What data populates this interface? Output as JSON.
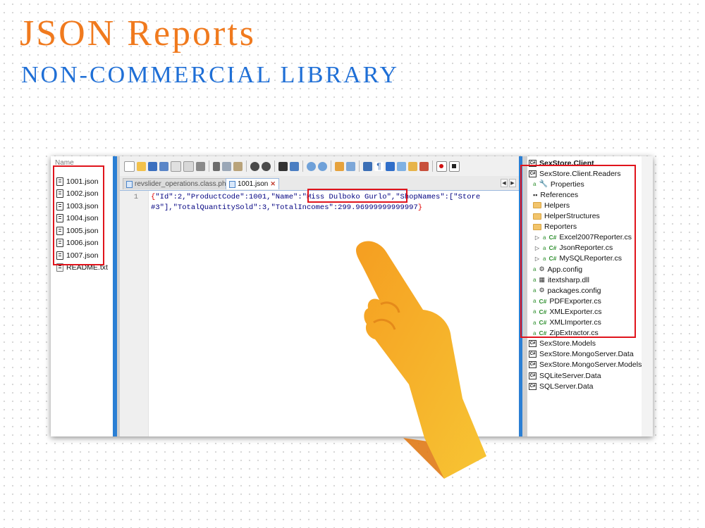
{
  "slide": {
    "title": "JSON Reports",
    "subtitle": "NON-COMMERCIAL LIBRARY"
  },
  "file_panel": {
    "header": "Name",
    "files": [
      "1001.json",
      "1002.json",
      "1003.json",
      "1004.json",
      "1005.json",
      "1006.json",
      "1007.json"
    ],
    "extra_file": "README.txt"
  },
  "editor": {
    "tabs": [
      {
        "label": "revslider_operations.class.php",
        "active": false
      },
      {
        "label": "1001.json",
        "active": true
      }
    ],
    "line_number": "1",
    "code_lines": [
      "{\"Id\":2,\"ProductCode\":1001,\"Name\":\"Miss Dulboko Gurlo\",\"ShopNames\":[\"Store",
      "#3\"],\"TotalQuantitySold\":3,\"TotalIncomes\":299.96999999999997}"
    ]
  },
  "solution_explorer": {
    "items": [
      {
        "label": "SexStore.Client",
        "kind": "project",
        "bold": true
      },
      {
        "label": "SexStore.Client.Readers",
        "kind": "project"
      },
      {
        "label": "Properties",
        "kind": "properties"
      },
      {
        "label": "References",
        "kind": "references"
      },
      {
        "label": "Helpers",
        "kind": "folder"
      },
      {
        "label": "HelperStructures",
        "kind": "folder"
      },
      {
        "label": "Reporters",
        "kind": "folder"
      },
      {
        "label": "Excel2007Reporter.cs",
        "kind": "cs",
        "expandable": true
      },
      {
        "label": "JsonReporter.cs",
        "kind": "cs",
        "expandable": true
      },
      {
        "label": "MySQLReporter.cs",
        "kind": "cs",
        "expandable": true
      },
      {
        "label": "App.config",
        "kind": "config"
      },
      {
        "label": "itextsharp.dll",
        "kind": "dll"
      },
      {
        "label": "packages.config",
        "kind": "config"
      },
      {
        "label": "PDFExporter.cs",
        "kind": "cs"
      },
      {
        "label": "XMLExporter.cs",
        "kind": "cs"
      },
      {
        "label": "XMLImporter.cs",
        "kind": "cs"
      },
      {
        "label": "ZipExtractor.cs",
        "kind": "cs"
      },
      {
        "label": "SexStore.Models",
        "kind": "project"
      },
      {
        "label": "SexStore.MongoServer.Data",
        "kind": "project"
      },
      {
        "label": "SexStore.MongoServer.Models",
        "kind": "project"
      },
      {
        "label": "SQLiteServer.Data",
        "kind": "project"
      },
      {
        "label": "SQLServer.Data",
        "kind": "project"
      }
    ]
  },
  "colors": {
    "title": "#f07a1e",
    "subtitle": "#1f6fd6",
    "highlight_box": "#e0141c",
    "splitter": "#2b7fd4",
    "hand_gradient": [
      "#f59e21",
      "#f7c534"
    ]
  }
}
